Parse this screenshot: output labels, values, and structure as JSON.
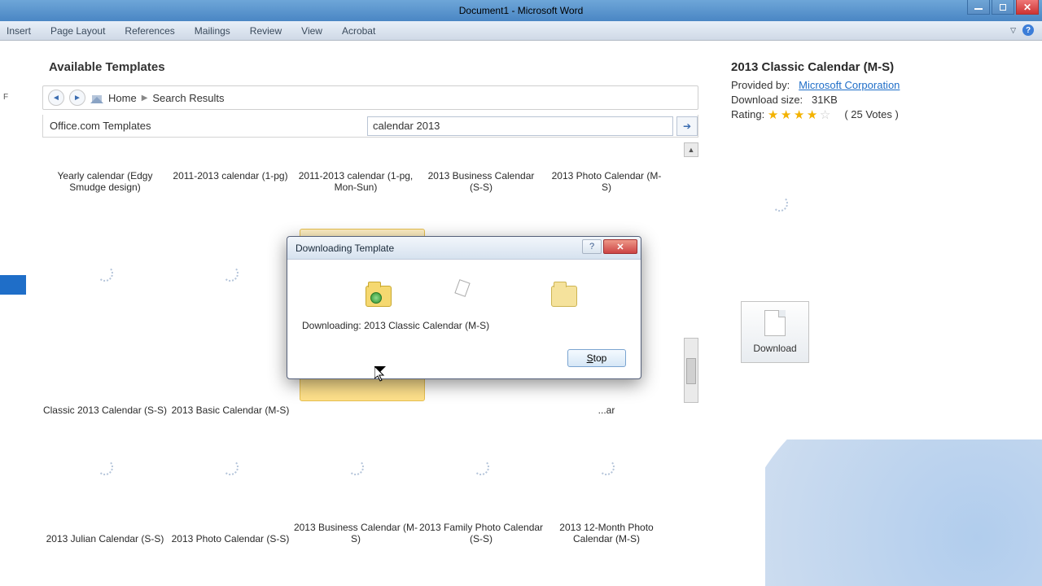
{
  "window": {
    "title": "Document1 - Microsoft Word"
  },
  "ribbon": {
    "tabs": [
      "Insert",
      "Page Layout",
      "References",
      "Mailings",
      "Review",
      "View",
      "Acrobat"
    ],
    "file_initial": "F"
  },
  "backstage": {
    "section_title": "Available Templates",
    "breadcrumb": {
      "home": "Home",
      "current": "Search Results"
    },
    "search": {
      "label": "Office.com Templates",
      "value": "calendar 2013"
    }
  },
  "templates": {
    "row1": [
      "Yearly calendar (Edgy Smudge design)",
      "2011-2013 calendar (1-pg)",
      "2011-2013 calendar (1-pg, Mon-Sun)",
      "2013 Business Calendar (S-S)",
      "2013 Photo Calendar (M-S)"
    ],
    "row2": [
      "Classic 2013 Calendar (S-S)",
      "2013 Basic Calendar (M-S)",
      "",
      "",
      ""
    ],
    "row2_last_partial": "...ar",
    "row3": [
      "2013 Julian Calendar (S-S)",
      "2013 Photo Calendar (S-S)",
      "2013 Business Calendar (M-S)",
      "2013 Family Photo Calendar (S-S)",
      "2013 12-Month Photo Calendar (M-S)"
    ]
  },
  "details": {
    "name": "2013 Classic Calendar (M-S)",
    "provided_by_label": "Provided by:",
    "provider": "Microsoft Corporation",
    "size_label": "Download size:",
    "size": "31KB",
    "rating_label": "Rating:",
    "votes": "( 25 Votes )",
    "download": "Download"
  },
  "dialog": {
    "title": "Downloading Template",
    "text_label": "Downloading:",
    "text_item": "2013 Classic Calendar (M-S)",
    "stop": "Stop"
  }
}
